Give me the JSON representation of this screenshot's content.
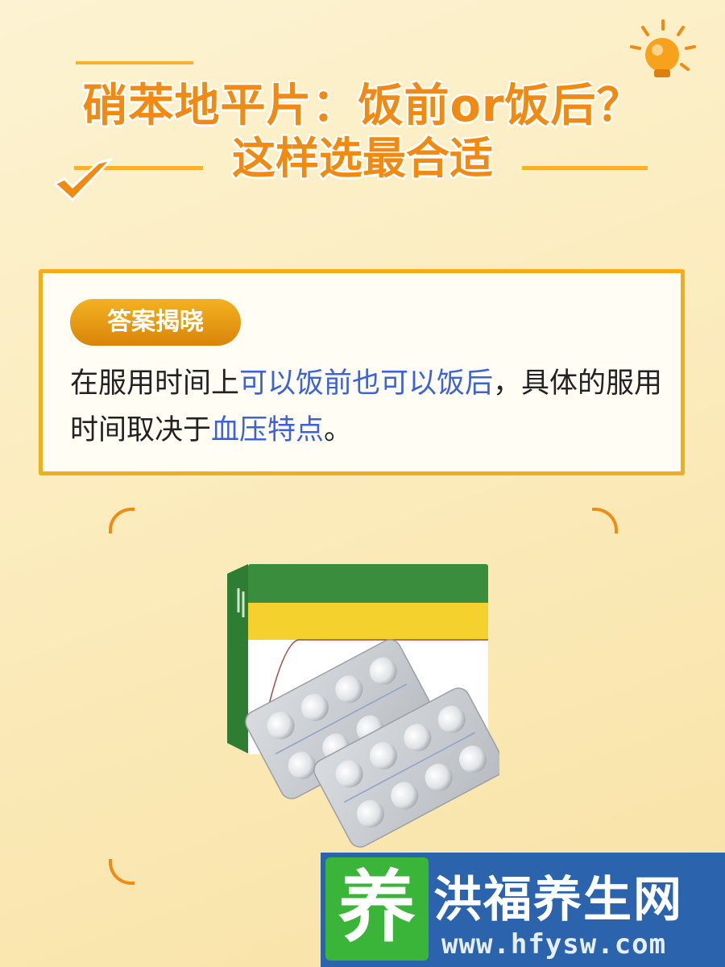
{
  "title": {
    "line1": "硝苯地平片：饭前or饭后？",
    "line2": "这样选最合适"
  },
  "card": {
    "badge": "答案揭晓",
    "text_part1": "在服用时间上",
    "highlight1": "可以饭前也可以饭后",
    "text_part2": "，具体的服用时间取决于",
    "highlight2": "血压特点",
    "text_part3": "。"
  },
  "watermark": {
    "logo_char": "养",
    "site_name": "洪福养生网",
    "url": "www.hfysw.com"
  },
  "colors": {
    "accent_orange": "#f08a12",
    "card_border": "#f2ad1a",
    "highlight_blue": "#3d62d8",
    "watermark_blue": "#2b63ad",
    "logo_green": "#3ab53a"
  },
  "icons": [
    "lightbulb-icon",
    "checkmark-icon"
  ]
}
